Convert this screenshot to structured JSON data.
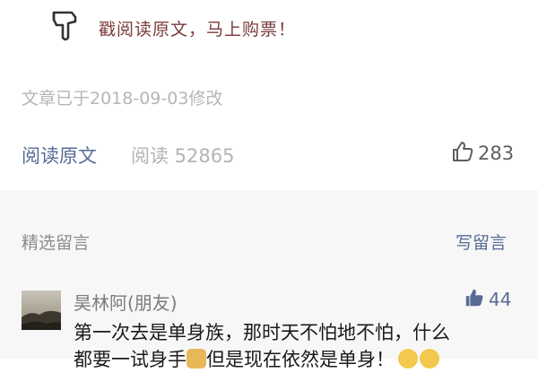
{
  "header": {
    "read_original_prompt": "戳阅读原文，马上购票！"
  },
  "article": {
    "modified_text": "文章已于2018-09-03修改"
  },
  "stats": {
    "read_original": "阅读原文",
    "read_count": "阅读 52865",
    "like_count": "283"
  },
  "comments": {
    "title": "精选留言",
    "write_label": "写留言",
    "items": [
      {
        "name": "昊林阿(朋友)",
        "likes": "44",
        "text_line1": "第一次去是单身族，那时天不怕地不怕，什么",
        "text_line2_a": "都要一试身手",
        "text_line2_b": "但是现在依然是单身！"
      }
    ]
  },
  "icons": {
    "hand": "pointing-down-hand-icon",
    "thumb": "thumbs-up-icon"
  },
  "colors": {
    "link": "#576b95",
    "accent": "#7a3b3b"
  }
}
